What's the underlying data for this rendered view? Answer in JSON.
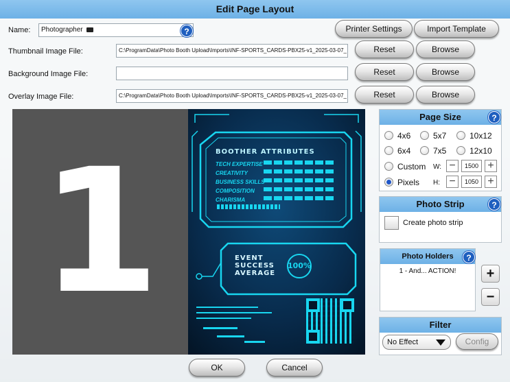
{
  "window": {
    "title": "Edit Page Layout"
  },
  "name_field": {
    "label": "Name:",
    "value": "Photographer",
    "help": "?"
  },
  "thumbnail": {
    "label": "Thumbnail Image File:",
    "value": "C:\\ProgramData\\Photo Booth Upload\\Imports\\INF-SPORTS_CARDS-PBX25-v1_2025-03-07_"
  },
  "background": {
    "label": "Background Image File:",
    "value": ""
  },
  "overlay": {
    "label": "Overlay Image File:",
    "value": "C:\\ProgramData\\Photo Booth Upload\\Imports\\INF-SPORTS_CARDS-PBX25-v1_2025-03-07_"
  },
  "buttons": {
    "printer_settings": "Printer Settings",
    "import_template": "Import Template",
    "reset": "Reset",
    "browse": "Browse",
    "ok": "OK",
    "cancel": "Cancel",
    "add": "+",
    "remove": "−",
    "config": "Config"
  },
  "preview": {
    "number": "1",
    "card": {
      "heading": "BOOTHER ATTRIBUTES",
      "attributes": [
        "TECH EXPERTISE",
        "CREATIVITY",
        "BUSINESS SKILLS",
        "COMPOSITION",
        "CHARISMA"
      ],
      "event_lines": [
        "EVENT",
        "SUCCESS",
        "AVERAGE"
      ],
      "percent": "100%"
    }
  },
  "page_size": {
    "title": "Page Size",
    "help": "?",
    "options": [
      "4x6",
      "5x7",
      "10x12",
      "6x4",
      "7x5",
      "12x10"
    ],
    "custom_label": "Custom",
    "pixels_label": "Pixels",
    "w_label": "W:",
    "h_label": "H:",
    "width": "1500",
    "height": "1050",
    "selected": "Pixels"
  },
  "photo_strip": {
    "title": "Photo Strip",
    "help": "?",
    "checkbox_label": "Create photo strip",
    "checked": false
  },
  "photo_holders": {
    "title": "Photo Holders",
    "help": "?",
    "items": [
      "1 - And... ACTION!"
    ]
  },
  "filter": {
    "title": "Filter",
    "selected": "No Effect"
  },
  "colors": {
    "accent": "#6db1e6",
    "selected_radio": "#1f56c8",
    "card_cyan": "#18d6f0"
  }
}
